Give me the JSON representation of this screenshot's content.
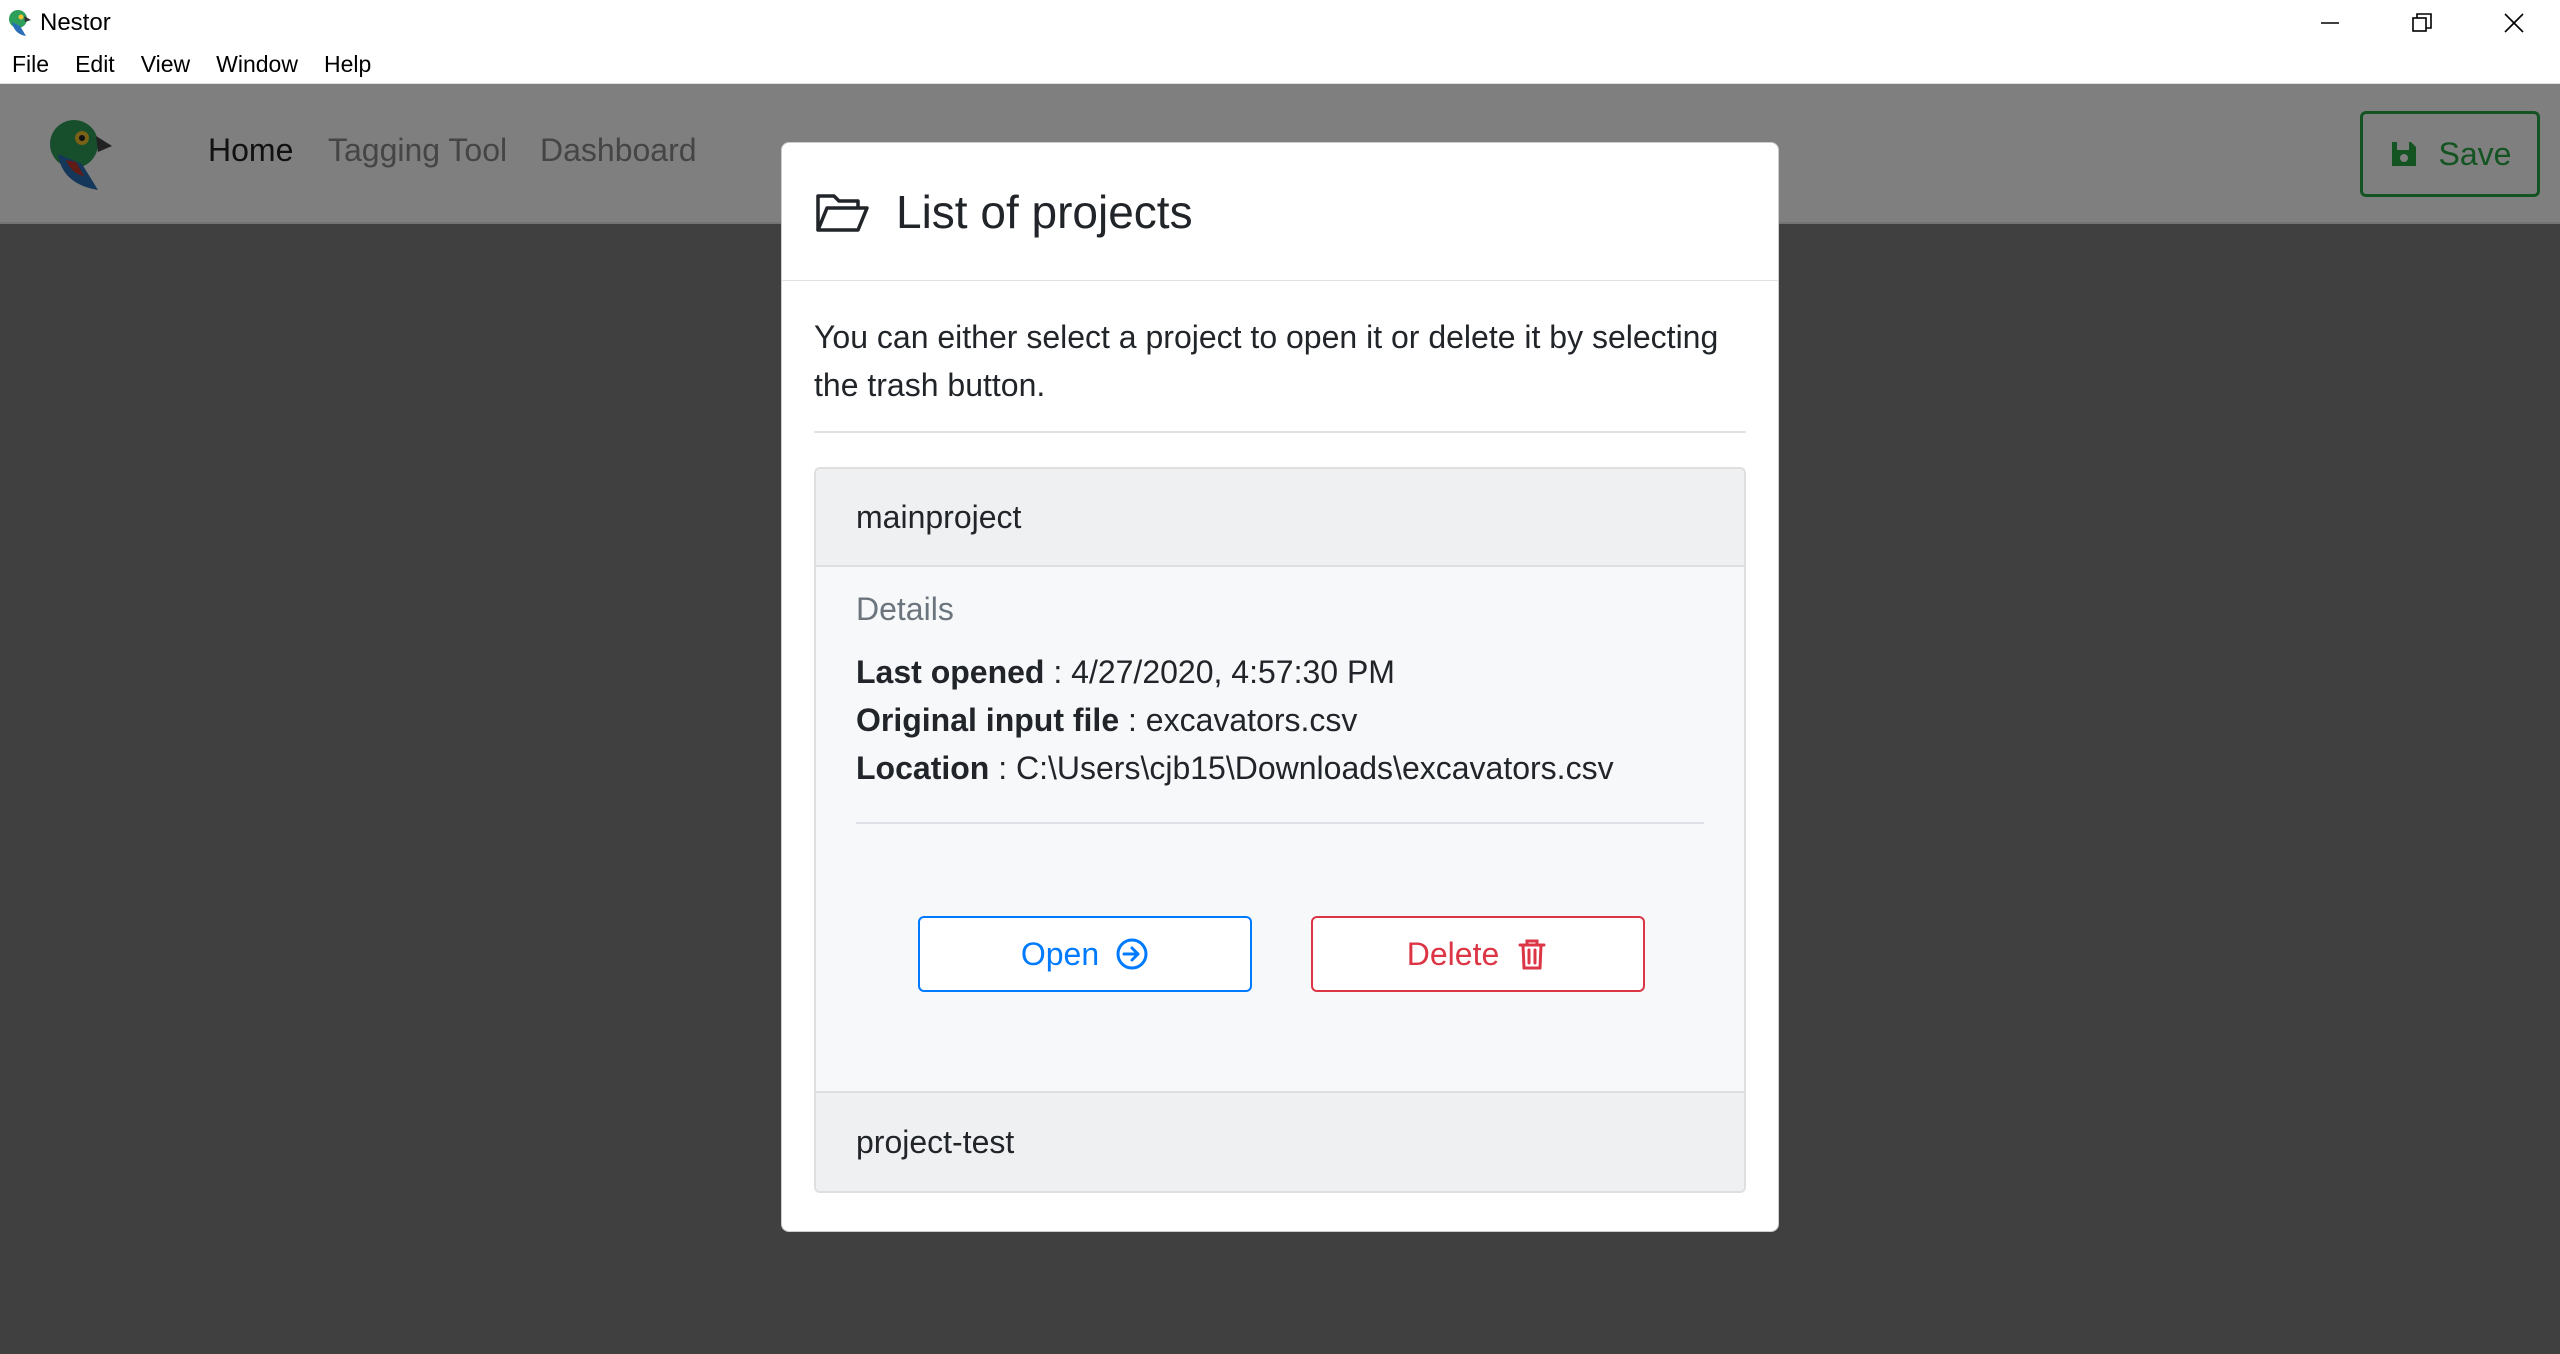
{
  "window": {
    "title": "Nestor",
    "icons": {
      "app": "parrot-icon",
      "minimize": "minimize-icon",
      "restore": "restore-icon",
      "close": "close-icon"
    }
  },
  "menu": [
    "File",
    "Edit",
    "View",
    "Window",
    "Help"
  ],
  "nav": {
    "logo": "parrot-logo",
    "links": [
      "Home",
      "Tagging Tool",
      "Dashboard"
    ],
    "active": "Home",
    "save_label": "Save"
  },
  "modal": {
    "title": "List of projects",
    "intro": "You can either select a project to open it or delete it by selecting the trash button.",
    "projects": [
      {
        "name": "mainproject",
        "details_title": "Details",
        "last_opened_label": "Last opened",
        "last_opened": " : 4/27/2020, 4:57:30 PM",
        "input_file_label": "Original input file",
        "input_file": " : excavators.csv",
        "location_label": "Location",
        "location": " : C:\\Users\\cjb15\\Downloads\\excavators.csv",
        "open_label": "Open",
        "delete_label": "Delete"
      },
      {
        "name": "project-test"
      }
    ]
  },
  "colors": {
    "primary": "#007bff",
    "danger": "#dc3545",
    "success": "#28a745"
  }
}
